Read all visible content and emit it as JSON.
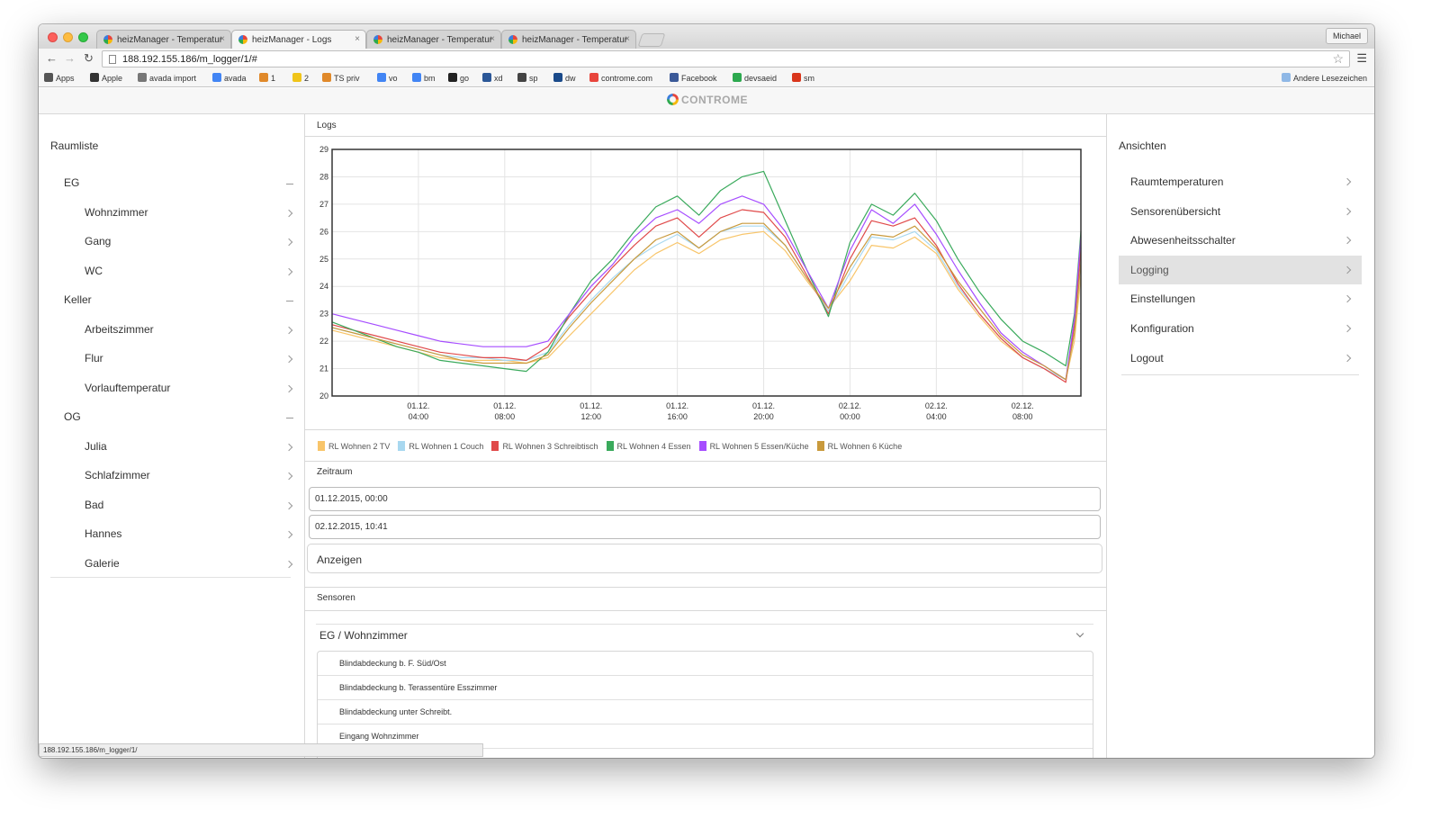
{
  "browser": {
    "tabs": [
      {
        "title": "heizManager - Temperatur"
      },
      {
        "title": "heizManager - Logs"
      },
      {
        "title": "heizManager - Temperatur"
      },
      {
        "title": "heizManager - Temperatur"
      }
    ],
    "active_tab": 1,
    "url": "188.192.155.186/m_logger/1/#",
    "profile": "Michael",
    "bookmarks": [
      {
        "label": "Apps",
        "icon": "apps-grid-icon",
        "color": "#555555"
      },
      {
        "label": "Apple",
        "icon": "apple-icon",
        "color": "#333333"
      },
      {
        "label": "avada import",
        "icon": "avada-icon",
        "color": "#777777"
      },
      {
        "label": "avada",
        "icon": "google-icon",
        "color": "#4285f4"
      },
      {
        "label": "1",
        "icon": "home-icon",
        "color": "#e0892a"
      },
      {
        "label": "2",
        "icon": "home-icon",
        "color": "#f0c419"
      },
      {
        "label": "TS priv",
        "icon": "home-icon",
        "color": "#e0892a"
      },
      {
        "label": "vo",
        "icon": "google-icon",
        "color": "#4285f4"
      },
      {
        "label": "bm",
        "icon": "google-icon",
        "color": "#4285f4"
      },
      {
        "label": "go",
        "icon": "go-icon",
        "color": "#222222"
      },
      {
        "label": "xd",
        "icon": "xd-icon",
        "color": "#2b5797"
      },
      {
        "label": "sp",
        "icon": "sp-icon",
        "color": "#444444"
      },
      {
        "label": "dw",
        "icon": "dw-icon",
        "color": "#1a4a8a"
      },
      {
        "label": "controme.com",
        "icon": "controme-icon",
        "color": "#e8453c"
      },
      {
        "label": "Facebook",
        "icon": "facebook-icon",
        "color": "#3b5998"
      },
      {
        "label": "devsaeid",
        "icon": "controme-icon",
        "color": "#2da94f"
      },
      {
        "label": "sm",
        "icon": "sm-icon",
        "color": "#d9361c"
      }
    ],
    "other_bookmarks": "Andere Lesezeichen",
    "status_url": "188.192.155.186/m_logger/1/"
  },
  "app": {
    "brand": "CONTROME"
  },
  "left": {
    "title": "Raumliste",
    "groups": [
      {
        "name": "EG",
        "rooms": [
          "Wohnzimmer",
          "Gang",
          "WC"
        ]
      },
      {
        "name": "Keller",
        "rooms": [
          "Arbeitszimmer",
          "Flur",
          "Vorlauftemperatur"
        ]
      },
      {
        "name": "OG",
        "rooms": [
          "Julia",
          "Schlafzimmer",
          "Bad",
          "Hannes",
          "Galerie"
        ]
      }
    ]
  },
  "main": {
    "logs_label": "Logs",
    "zeitraum_label": "Zeitraum",
    "from": "01.12.2015, 00:00",
    "to": "02.12.2015, 10:41",
    "show_button": "Anzeigen",
    "sensoren_label": "Sensoren",
    "accordion_title": "EG / Wohnzimmer",
    "sensors": [
      "Blindabdeckung b. F. Süd/Ost",
      "Blindabdeckung b. Terassentüre Esszimmer",
      "Blindabdeckung unter Schreibt.",
      "Eingang Wohnzimmer"
    ]
  },
  "chart_data": {
    "type": "line",
    "ylim": [
      20,
      29
    ],
    "yticks": [
      20,
      21,
      22,
      23,
      24,
      25,
      26,
      27,
      28,
      29
    ],
    "x_hours": [
      0,
      1,
      2,
      3,
      4,
      5,
      6,
      7,
      8,
      9,
      10,
      11,
      12,
      13,
      14,
      15,
      16,
      17,
      18,
      19,
      20,
      21,
      22,
      23,
      24,
      25,
      26,
      27,
      28,
      29,
      30,
      31,
      32,
      33,
      34,
      34.4,
      34.7
    ],
    "xticks": [
      {
        "h": 4,
        "label": [
          "01.12.",
          "04:00"
        ]
      },
      {
        "h": 8,
        "label": [
          "01.12.",
          "08:00"
        ]
      },
      {
        "h": 12,
        "label": [
          "01.12.",
          "12:00"
        ]
      },
      {
        "h": 16,
        "label": [
          "01.12.",
          "16:00"
        ]
      },
      {
        "h": 20,
        "label": [
          "01.12.",
          "20:00"
        ]
      },
      {
        "h": 24,
        "label": [
          "02.12.",
          "00:00"
        ]
      },
      {
        "h": 28,
        "label": [
          "02.12.",
          "04:00"
        ]
      },
      {
        "h": 32,
        "label": [
          "02.12.",
          "08:00"
        ]
      }
    ],
    "xlim": [
      0,
      34.7
    ],
    "series": [
      {
        "name": "RL Wohnen 2 TV",
        "color": "#f8c56a",
        "values": [
          22.4,
          22.2,
          22.0,
          21.8,
          21.6,
          21.4,
          21.3,
          21.3,
          21.3,
          21.2,
          21.4,
          22.2,
          23.0,
          23.8,
          24.6,
          25.2,
          25.6,
          25.2,
          25.7,
          25.9,
          26.0,
          25.3,
          24.2,
          23.2,
          24.2,
          25.5,
          25.4,
          25.8,
          25.2,
          23.9,
          22.9,
          22.0,
          21.4,
          21.0,
          20.6,
          22.0,
          24.4
        ]
      },
      {
        "name": "RL Wohnen 1 Couch",
        "color": "#a8d8f0",
        "values": [
          22.5,
          22.3,
          22.1,
          21.9,
          21.7,
          21.5,
          21.4,
          21.4,
          21.3,
          21.3,
          21.6,
          22.6,
          23.5,
          24.3,
          25.0,
          25.5,
          25.9,
          25.4,
          26.0,
          26.2,
          26.2,
          25.5,
          24.3,
          23.1,
          24.5,
          25.8,
          25.7,
          26.0,
          25.3,
          24.0,
          23.0,
          22.1,
          21.4,
          21.0,
          20.6,
          22.3,
          25.0
        ]
      },
      {
        "name": "RL Wohnen 3 Schreibtisch",
        "color": "#e04a4a",
        "values": [
          22.6,
          22.4,
          22.2,
          22.0,
          21.8,
          21.6,
          21.5,
          21.4,
          21.4,
          21.3,
          21.8,
          22.9,
          23.8,
          24.7,
          25.5,
          26.2,
          26.5,
          25.8,
          26.5,
          26.8,
          26.7,
          25.8,
          24.4,
          23.0,
          25.0,
          26.4,
          26.2,
          26.5,
          25.5,
          24.1,
          23.0,
          22.1,
          21.4,
          21.0,
          20.5,
          22.6,
          25.4
        ]
      },
      {
        "name": "RL Wohnen 4 Essen",
        "color": "#3aaa5c",
        "values": [
          22.7,
          22.4,
          22.1,
          21.8,
          21.6,
          21.3,
          21.2,
          21.1,
          21.0,
          20.9,
          21.6,
          23.0,
          24.2,
          25.0,
          26.0,
          26.9,
          27.3,
          26.6,
          27.5,
          28.0,
          28.2,
          26.4,
          24.6,
          22.9,
          25.6,
          27.0,
          26.6,
          27.4,
          26.4,
          25.0,
          23.8,
          22.8,
          22.0,
          21.6,
          21.1,
          23.0,
          26.0
        ]
      },
      {
        "name": "RL Wohnen 5 Essen/Küche",
        "color": "#a64dff",
        "values": [
          23.0,
          22.8,
          22.6,
          22.4,
          22.2,
          22.0,
          21.9,
          21.8,
          21.8,
          21.8,
          22.0,
          23.0,
          24.0,
          24.8,
          25.8,
          26.5,
          26.8,
          26.3,
          27.0,
          27.3,
          27.0,
          26.0,
          24.6,
          23.2,
          25.3,
          26.8,
          26.3,
          27.0,
          25.9,
          24.6,
          23.4,
          22.3,
          21.6,
          21.1,
          20.6,
          22.8,
          25.8
        ]
      },
      {
        "name": "RL Wohnen 6 Küche",
        "color": "#c99a3c",
        "values": [
          22.5,
          22.3,
          22.1,
          21.9,
          21.7,
          21.5,
          21.3,
          21.2,
          21.2,
          21.2,
          21.5,
          22.5,
          23.4,
          24.2,
          25.0,
          25.7,
          26.0,
          25.4,
          26.0,
          26.3,
          26.3,
          25.5,
          24.3,
          23.2,
          24.7,
          25.9,
          25.8,
          26.2,
          25.4,
          24.2,
          23.2,
          22.2,
          21.5,
          21.1,
          20.6,
          22.3,
          24.9
        ]
      }
    ]
  },
  "right": {
    "title": "Ansichten",
    "items": [
      "Raumtemperaturen",
      "Sensorenübersicht",
      "Abwesenheitsschalter",
      "Logging",
      "Einstellungen",
      "Konfiguration",
      "Logout"
    ],
    "active_index": 3
  }
}
